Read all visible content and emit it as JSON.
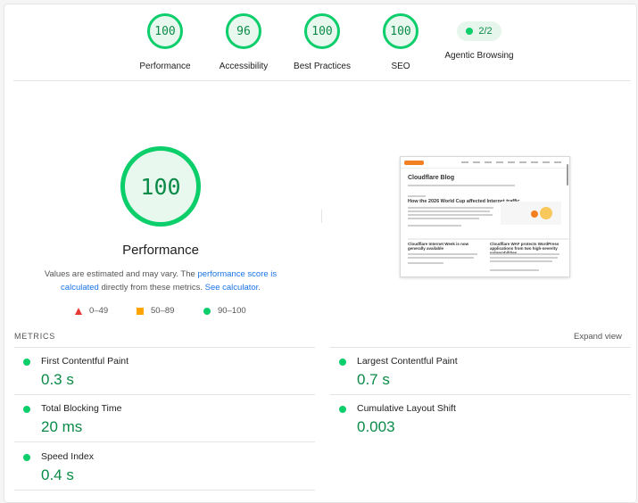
{
  "categories": [
    {
      "label": "Performance",
      "score": "100"
    },
    {
      "label": "Accessibility",
      "score": "96"
    },
    {
      "label": "Best Practices",
      "score": "100"
    },
    {
      "label": "SEO",
      "score": "100"
    },
    {
      "label": "Agentic Browsing",
      "score": "2/2"
    }
  ],
  "main": {
    "score": "100",
    "title": "Performance",
    "desc_pre": "Values are estimated and may vary. The ",
    "desc_link1": "performance score is calculated",
    "desc_mid": " directly from these metrics. ",
    "desc_link2": "See calculator.",
    "legend": {
      "fail": "0–49",
      "average": "50–89",
      "pass": "90–100"
    }
  },
  "thumbnail": {
    "blog_title": "Cloudflare Blog",
    "article1_title": "How the 2026 World Cup affected Internet traffic",
    "article2_title": "Cloudflare Internet Week is now generally available",
    "article3_title": "Cloudflare WAF protects WordPress applications from two high-severity vulnerabilities"
  },
  "metrics": {
    "header": "METRICS",
    "expand": "Expand view",
    "items": [
      {
        "name": "First Contentful Paint",
        "value": "0.3 s"
      },
      {
        "name": "Largest Contentful Paint",
        "value": "0.7 s"
      },
      {
        "name": "Total Blocking Time",
        "value": "20 ms"
      },
      {
        "name": "Cumulative Layout Shift",
        "value": "0.003"
      },
      {
        "name": "Speed Index",
        "value": "0.4 s"
      }
    ]
  },
  "colors": {
    "pass": "#0cce6b",
    "average": "#ffa400",
    "fail": "#e53935",
    "link": "#1a73e8"
  }
}
